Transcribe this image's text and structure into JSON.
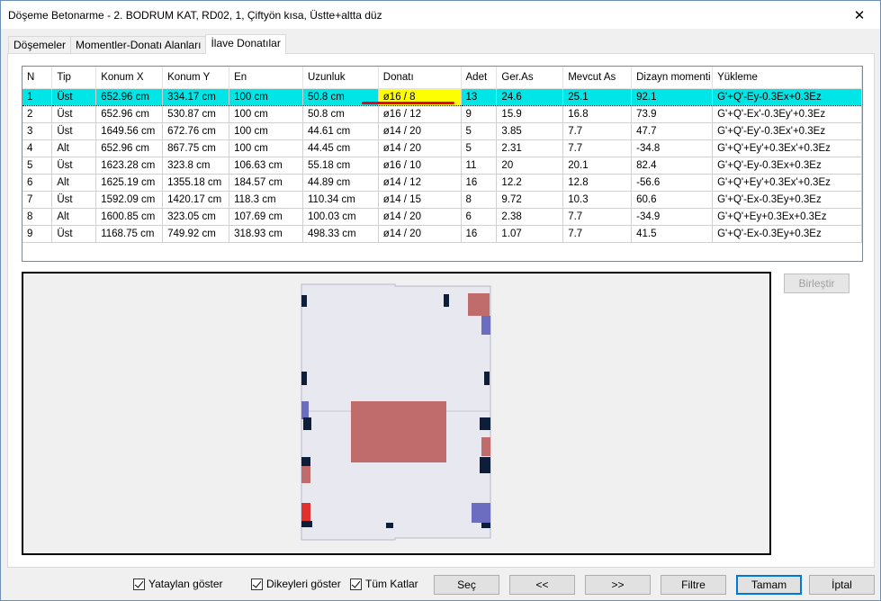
{
  "window": {
    "title": "Döşeme Betonarme - 2. BODRUM KAT, RD02, 1, Çiftyön kısa, Üstte+altta düz",
    "close_glyph": "✕"
  },
  "tabs": [
    {
      "label": "Döşemeler"
    },
    {
      "label": "Momentler-Donatı Alanları"
    },
    {
      "label": "İlave Donatılar"
    }
  ],
  "table": {
    "columns": [
      "N",
      "Tip",
      "Konum X",
      "Konum Y",
      "En",
      "Uzunluk",
      "Donatı",
      "Adet",
      "Ger.As",
      "Mevcut As",
      "Dizayn momenti",
      "Yükleme"
    ],
    "rows": [
      [
        "1",
        "Üst",
        "652.96 cm",
        "334.17 cm",
        "100 cm",
        "50.8 cm",
        "ø16 / 8",
        "13",
        "24.6",
        "25.1",
        "92.1",
        "G'+Q'-Ey-0.3Ex+0.3Ez"
      ],
      [
        "2",
        "Üst",
        "652.96 cm",
        "530.87 cm",
        "100 cm",
        "50.8 cm",
        "ø16 / 12",
        "9",
        "15.9",
        "16.8",
        "73.9",
        "G'+Q'-Ex'-0.3Ey'+0.3Ez"
      ],
      [
        "3",
        "Üst",
        "1649.56 cm",
        "672.76 cm",
        "100 cm",
        "44.61 cm",
        "ø14 / 20",
        "5",
        "3.85",
        "7.7",
        "47.7",
        "G'+Q'-Ey'-0.3Ex'+0.3Ez"
      ],
      [
        "4",
        "Alt",
        "652.96 cm",
        "867.75 cm",
        "100 cm",
        "44.45 cm",
        "ø14 / 20",
        "5",
        "2.31",
        "7.7",
        "-34.8",
        "G'+Q'+Ey'+0.3Ex'+0.3Ez"
      ],
      [
        "5",
        "Üst",
        "1623.28 cm",
        "323.8 cm",
        "106.63 cm",
        "55.18 cm",
        "ø16 / 10",
        "11",
        "20",
        "20.1",
        "82.4",
        "G'+Q'-Ey-0.3Ex+0.3Ez"
      ],
      [
        "6",
        "Alt",
        "1625.19 cm",
        "1355.18 cm",
        "184.57 cm",
        "44.89 cm",
        "ø14 / 12",
        "16",
        "12.2",
        "12.8",
        "-56.6",
        "G'+Q'+Ey'+0.3Ex'+0.3Ez"
      ],
      [
        "7",
        "Üst",
        "1592.09 cm",
        "1420.17 cm",
        "118.3 cm",
        "110.34 cm",
        "ø14 / 15",
        "8",
        "9.72",
        "10.3",
        "60.6",
        "G'+Q'-Ex-0.3Ey+0.3Ez"
      ],
      [
        "8",
        "Alt",
        "1600.85 cm",
        "323.05 cm",
        "107.69 cm",
        "100.03 cm",
        "ø14 / 20",
        "6",
        "2.38",
        "7.7",
        "-34.9",
        "G'+Q'+Ey+0.3Ex+0.3Ez"
      ],
      [
        "9",
        "Üst",
        "1168.75 cm",
        "749.92 cm",
        "318.93 cm",
        "498.33 cm",
        "ø14 / 20",
        "16",
        "1.07",
        "7.7",
        "41.5",
        "G'+Q'-Ex-0.3Ey+0.3Ez"
      ]
    ],
    "selected_row": 0
  },
  "buttons": {
    "birlestir": "Birleştir",
    "sec": "Seç",
    "prev": "<<",
    "next": ">>",
    "filtre": "Filtre",
    "tamam": "Tamam",
    "iptal": "İptal"
  },
  "checkboxes": [
    {
      "label": "Yataylan göster",
      "checked": true
    },
    {
      "label": "Dikeyleri göster",
      "checked": true
    },
    {
      "label": "Tüm Katlar",
      "checked": true
    }
  ],
  "colors": {
    "selection": "#00e5e5",
    "highlight": "#ffff00",
    "slab": "#e8e8f0",
    "top_rebar": "#c06c6c",
    "bottom_rebar": "#6c6cc0",
    "column": "#0d1e3a",
    "underline": "#e8001c"
  }
}
